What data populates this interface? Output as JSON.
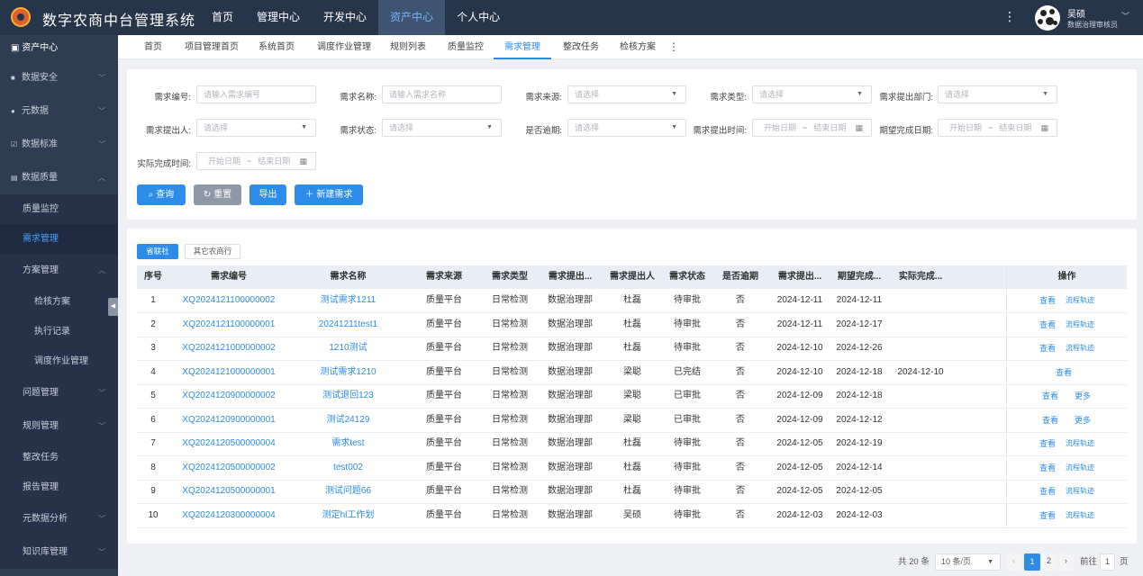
{
  "app": {
    "title": "数字农商中台管理系统"
  },
  "topnav": {
    "items": [
      "首页",
      "管理中心",
      "开发中心",
      "资产中心",
      "个人中心"
    ],
    "active_index": 3
  },
  "user": {
    "name": "吴硕",
    "role": "数据治理审核员"
  },
  "sidebar": {
    "header": "资产中心",
    "items": {
      "data_security": "数据安全",
      "metadata": "元数据",
      "data_standard": "数据标准",
      "data_quality": "数据质量",
      "quality_monitor": "质量监控",
      "requirement_mgmt": "需求管理",
      "plan_mgmt": "方案管理",
      "inspection_plan": "检核方案",
      "exec_record": "执行记录",
      "schedule_job": "调度作业管理",
      "issue_mgmt": "问题管理",
      "rule_mgmt": "规则管理",
      "rectify_task": "整改任务",
      "report_mgmt": "报告管理",
      "metadata_analysis": "元数据分析",
      "knowledge_mgmt": "知识库管理"
    }
  },
  "tabs": [
    "首页",
    "项目管理首页",
    "系统首页",
    "调度作业管理",
    "规则列表",
    "质量监控",
    "需求管理",
    "整改任务",
    "检核方案"
  ],
  "active_tab": "需求管理",
  "filters": {
    "req_no": {
      "label": "需求编号:",
      "placeholder": "请输入需求编号"
    },
    "req_name": {
      "label": "需求名称:",
      "placeholder": "请输入需求名称"
    },
    "req_source": {
      "label": "需求来源:",
      "placeholder": "请选择"
    },
    "req_type": {
      "label": "需求类型:",
      "placeholder": "请选择"
    },
    "req_dept": {
      "label": "需求提出部门:",
      "placeholder": "请选择"
    },
    "req_person": {
      "label": "需求提出人:",
      "placeholder": "请选择"
    },
    "req_status": {
      "label": "需求状态:",
      "placeholder": "请选择"
    },
    "overdue": {
      "label": "是否逾期:",
      "placeholder": "请选择"
    },
    "req_time": {
      "label": "需求提出时间:",
      "start": "开始日期",
      "end": "结束日期"
    },
    "expect_date": {
      "label": "期望完成日期:",
      "start": "开始日期",
      "end": "结束日期"
    },
    "actual_time": {
      "label": "实际完成时间:",
      "start": "开始日期",
      "end": "结束日期"
    },
    "range_sep": "~"
  },
  "buttons": {
    "query": "查询",
    "reset": "重置",
    "export": "导出",
    "new": "新建需求"
  },
  "table_tabs": [
    "省联社",
    "其它农商行"
  ],
  "table": {
    "columns": [
      "序号",
      "需求编号",
      "需求名称",
      "需求来源",
      "需求类型",
      "需求提出...",
      "需求提出人",
      "需求状态",
      "是否逾期",
      "需求提出...",
      "期望完成...",
      "实际完成...",
      "操作"
    ],
    "rows": [
      {
        "idx": "1",
        "no": "XQ2024121100000002",
        "name": "测试需求1211",
        "source": "质量平台",
        "type": "日常检测",
        "dept": "数据治理部",
        "person": "杜磊",
        "status": "待审批",
        "overdue": "否",
        "created": "2024-12-11",
        "expected": "2024-12-11",
        "actual": "",
        "ops": [
          "查看",
          "流程轨迹"
        ]
      },
      {
        "idx": "2",
        "no": "XQ2024121100000001",
        "name": "20241211test1",
        "source": "质量平台",
        "type": "日常检测",
        "dept": "数据治理部",
        "person": "杜磊",
        "status": "待审批",
        "overdue": "否",
        "created": "2024-12-11",
        "expected": "2024-12-17",
        "actual": "",
        "ops": [
          "查看",
          "流程轨迹"
        ]
      },
      {
        "idx": "3",
        "no": "XQ2024121000000002",
        "name": "1210测试",
        "source": "质量平台",
        "type": "日常检测",
        "dept": "数据治理部",
        "person": "杜磊",
        "status": "待审批",
        "overdue": "否",
        "created": "2024-12-10",
        "expected": "2024-12-26",
        "actual": "",
        "ops": [
          "查看",
          "流程轨迹"
        ]
      },
      {
        "idx": "4",
        "no": "XQ2024121000000001",
        "name": "测试需求1210",
        "source": "质量平台",
        "type": "日常检测",
        "dept": "数据治理部",
        "person": "梁聪",
        "status": "已完结",
        "overdue": "否",
        "created": "2024-12-10",
        "expected": "2024-12-18",
        "actual": "2024-12-10",
        "ops": [
          "查看"
        ]
      },
      {
        "idx": "5",
        "no": "XQ2024120900000002",
        "name": "测试退回123",
        "source": "质量平台",
        "type": "日常检测",
        "dept": "数据治理部",
        "person": "梁聪",
        "status": "已审批",
        "overdue": "否",
        "created": "2024-12-09",
        "expected": "2024-12-18",
        "actual": "",
        "ops": [
          "查看",
          "更多"
        ]
      },
      {
        "idx": "6",
        "no": "XQ2024120900000001",
        "name": "测试24129",
        "source": "质量平台",
        "type": "日常检测",
        "dept": "数据治理部",
        "person": "梁聪",
        "status": "已审批",
        "overdue": "否",
        "created": "2024-12-09",
        "expected": "2024-12-12",
        "actual": "",
        "ops": [
          "查看",
          "更多"
        ]
      },
      {
        "idx": "7",
        "no": "XQ2024120500000004",
        "name": "需求test",
        "source": "质量平台",
        "type": "日常检测",
        "dept": "数据治理部",
        "person": "杜磊",
        "status": "待审批",
        "overdue": "否",
        "created": "2024-12-05",
        "expected": "2024-12-19",
        "actual": "",
        "ops": [
          "查看",
          "流程轨迹"
        ]
      },
      {
        "idx": "8",
        "no": "XQ2024120500000002",
        "name": "test002",
        "source": "质量平台",
        "type": "日常检测",
        "dept": "数据治理部",
        "person": "杜磊",
        "status": "待审批",
        "overdue": "否",
        "created": "2024-12-05",
        "expected": "2024-12-14",
        "actual": "",
        "ops": [
          "查看",
          "流程轨迹"
        ]
      },
      {
        "idx": "9",
        "no": "XQ2024120500000001",
        "name": "测试问题66",
        "source": "质量平台",
        "type": "日常检测",
        "dept": "数据治理部",
        "person": "杜磊",
        "status": "待审批",
        "overdue": "否",
        "created": "2024-12-05",
        "expected": "2024-12-05",
        "actual": "",
        "ops": [
          "查看",
          "流程轨迹"
        ]
      },
      {
        "idx": "10",
        "no": "XQ2024120300000004",
        "name": "测定hl工作划",
        "source": "质量平台",
        "type": "日常检测",
        "dept": "数据治理部",
        "person": "吴硕",
        "status": "待审批",
        "overdue": "否",
        "created": "2024-12-03",
        "expected": "2024-12-03",
        "actual": "",
        "ops": [
          "查看",
          "流程轨迹"
        ]
      }
    ]
  },
  "pagination": {
    "total": "共 20 条",
    "page_size": "10 条/页",
    "pages": [
      "1",
      "2"
    ],
    "current": "1",
    "goto_label": "前往",
    "goto_value": "1",
    "page_suffix": "页",
    "prev": "‹",
    "next": "›"
  },
  "colors": {
    "topbar": "#27354a",
    "sidebar": "#2f3d52",
    "primary": "#2d8ce8",
    "active_top": "#79b3ff"
  }
}
